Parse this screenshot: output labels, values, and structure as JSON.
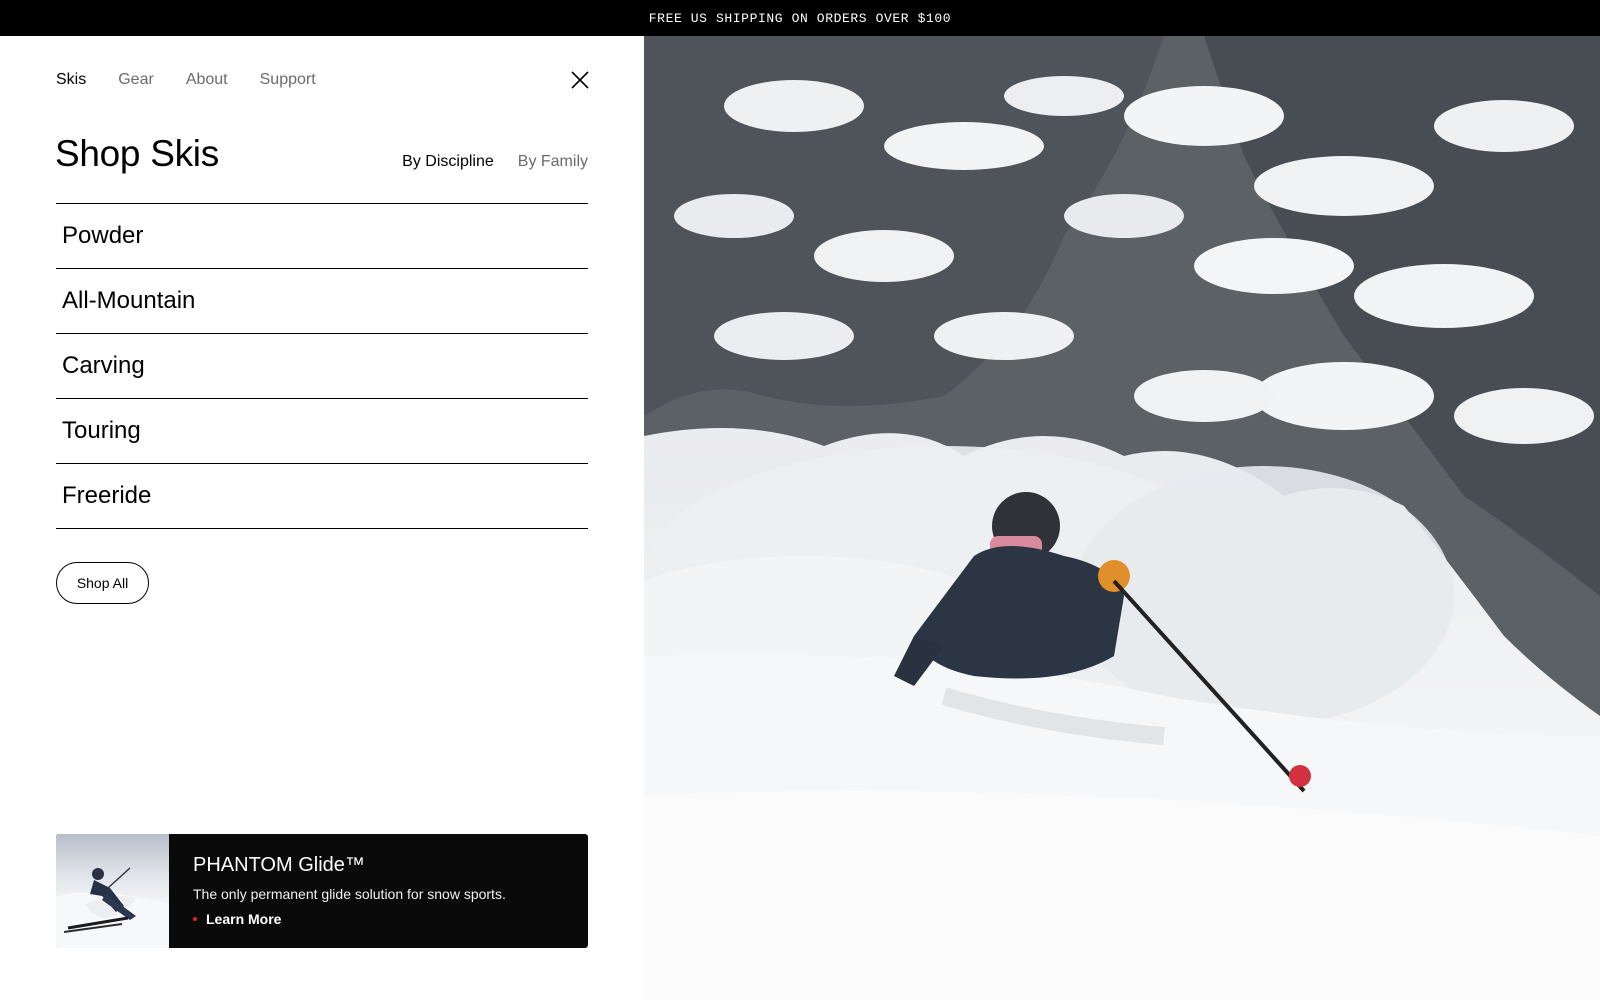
{
  "announcement": "FREE US SHIPPING ON ORDERS OVER $100",
  "nav": {
    "items": [
      {
        "label": "Skis",
        "active": true
      },
      {
        "label": "Gear",
        "active": false
      },
      {
        "label": "About",
        "active": false
      },
      {
        "label": "Support",
        "active": false
      }
    ],
    "close_icon": "close-icon"
  },
  "heading": "Shop Skis",
  "tabs": [
    {
      "label": "By Discipline",
      "active": true
    },
    {
      "label": "By Family",
      "active": false
    }
  ],
  "categories": [
    "Powder",
    "All-Mountain",
    "Carving",
    "Touring",
    "Freeride"
  ],
  "shop_all_label": "Shop All",
  "promo": {
    "title": "PHANTOM Glide™",
    "description": "The only permanent glide solution for snow sports.",
    "link_label": "Learn More",
    "accent_color": "#e0202c"
  },
  "colors": {
    "announcement_bg": "#000000",
    "promo_bg": "#0a0a0a",
    "muted_text": "#6b6b6b"
  }
}
